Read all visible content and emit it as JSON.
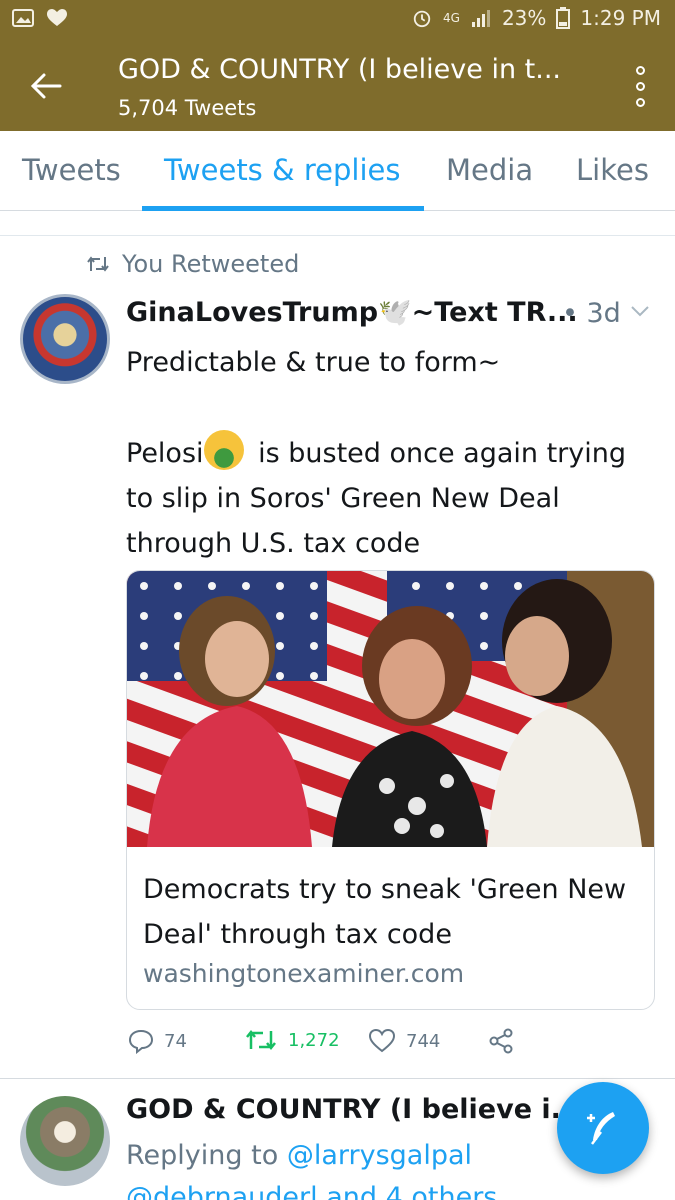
{
  "status_bar": {
    "battery": "23%",
    "time": "1:29 PM",
    "network": "4G",
    "icons": [
      "image-icon",
      "heart-icon",
      "alarm-icon",
      "signal-icon",
      "battery-icon"
    ]
  },
  "header": {
    "title": "GOD & COUNTRY (I believe in t...",
    "subtitle": "5,704 Tweets",
    "back_icon": "back-arrow-icon",
    "menu_icon": "overflow-menu-icon",
    "color": "#7f6c2c"
  },
  "tabs": [
    {
      "label": "Tweets",
      "active": false
    },
    {
      "label": "Tweets & replies",
      "active": true
    },
    {
      "label": "Media",
      "active": false
    },
    {
      "label": "Likes",
      "active": false
    }
  ],
  "tweet": {
    "retweet_label": "You Retweeted",
    "author": "GinaLovesTrump🕊️~Text TR...",
    "time": "• 3d",
    "text_line1": "Predictable & true to form~",
    "text_line2_a": "Pelosi",
    "text_line2_b": " is busted once again trying to slip in Soros' Green New Deal through U.S. tax code",
    "card": {
      "title": "Democrats try to sneak 'Green New Deal' through tax code",
      "domain": "washingtonexaminer.com"
    },
    "replies": "74",
    "retweets": "1,272",
    "likes": "744"
  },
  "next_tweet": {
    "author": "GOD & COUNTRY (I believe i...",
    "reply_prefix": "Replying to ",
    "reply_handle": "@larrysgalpal",
    "reply_line2": "@debrnauderl and 4 others"
  },
  "colors": {
    "accent": "#1da1f2",
    "retweet": "#17bf63",
    "muted": "#657786"
  }
}
